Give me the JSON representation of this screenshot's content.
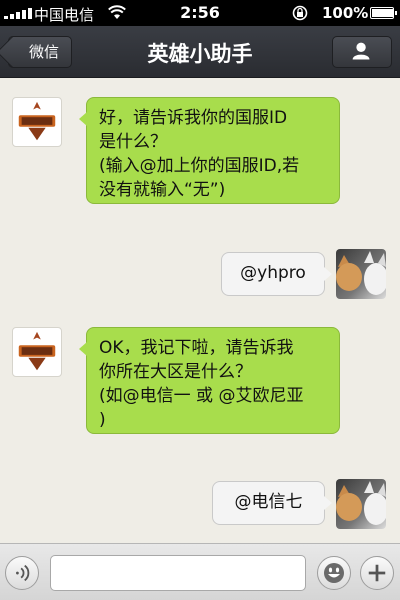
{
  "status_bar": {
    "carrier": "中国电信",
    "time": "2:56",
    "battery": "100%",
    "battery_level": 1.0
  },
  "nav": {
    "back_label": "微信",
    "title": "英雄小助手",
    "profile_icon": "person-icon"
  },
  "messages": [
    {
      "side": "left",
      "sender": "bot",
      "lines": [
        "好，请告诉我你的国服ID",
        "是什么？",
        "(输入@加上你的国服ID,若",
        "没有就输入“无”)"
      ]
    },
    {
      "side": "right",
      "sender": "me",
      "lines": [
        "@yhpro"
      ]
    },
    {
      "side": "left",
      "sender": "bot",
      "lines": [
        "OK，我记下啦，请告诉我",
        "你所在大区是什么？",
        "(如@电信一 或 @艾欧尼亚",
        ")"
      ]
    },
    {
      "side": "right",
      "sender": "me",
      "lines": [
        "@电信七"
      ]
    }
  ],
  "input_bar": {
    "voice_icon": "voice-icon",
    "emoji_icon": "emoji-icon",
    "plus_icon": "plus-icon",
    "placeholder": ""
  },
  "colors": {
    "incoming_bubble": "#a8dd4c",
    "outgoing_bubble": "#f4f4f4",
    "nav_bg": "#2f3136"
  }
}
